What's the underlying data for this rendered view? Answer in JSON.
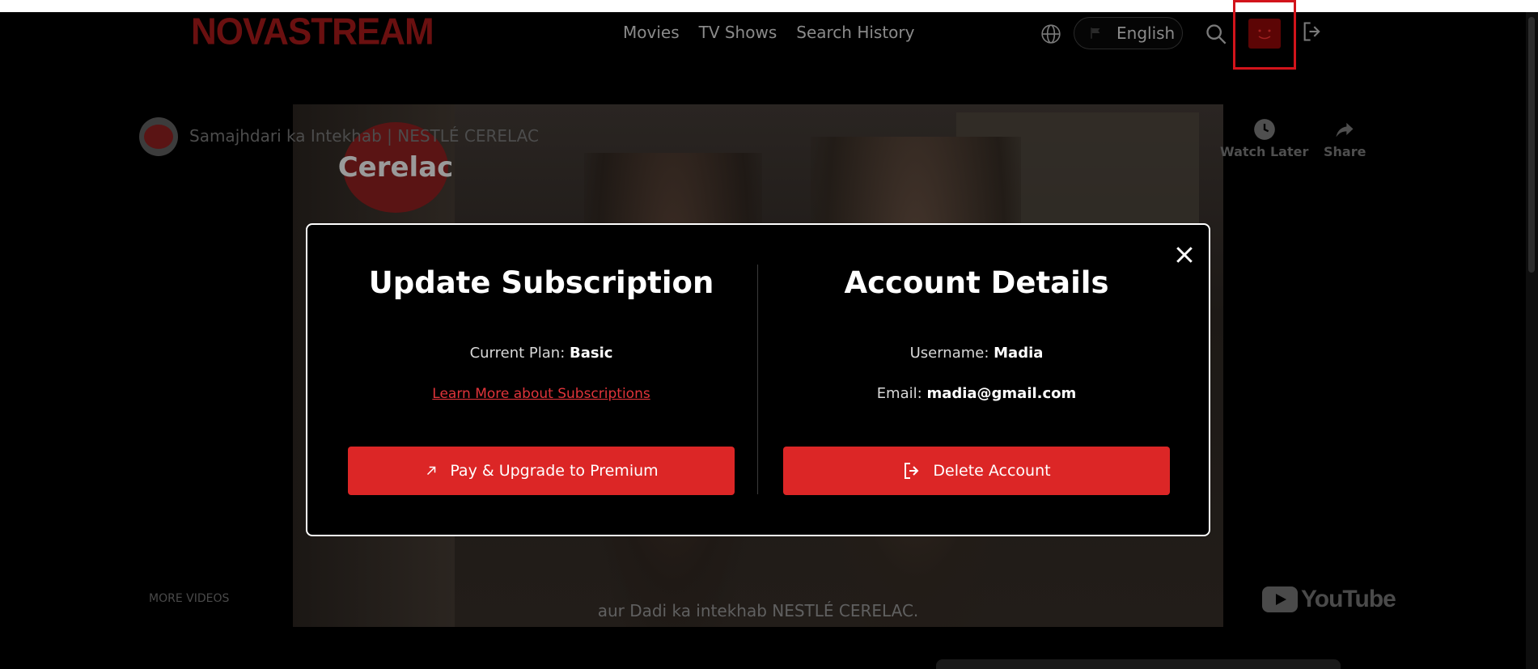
{
  "header": {
    "logo_text": "NOVASTREAM",
    "nav": [
      "Movies",
      "TV Shows",
      "Search History"
    ],
    "language": "English",
    "icons": [
      "globe-icon",
      "flag-icon",
      "search-icon",
      "avatar",
      "logout-icon"
    ]
  },
  "video": {
    "title": "Samajhdari ka Intekhab | NESTLÉ CERELAC",
    "logo_text": "Cerelac",
    "subtitle": "aur Dadi ka intekhab NESTLÉ CERELAC.",
    "watch_later": "Watch Later",
    "share": "Share",
    "more_videos": "MORE VIDEOS",
    "youtube": "YouTube"
  },
  "modal": {
    "subscription": {
      "title": "Update Subscription",
      "plan_label": "Current Plan:",
      "plan_value": "Basic",
      "learn_more": "Learn More about Subscriptions",
      "button": "Pay & Upgrade to Premium"
    },
    "account": {
      "title": "Account Details",
      "username_label": "Username:",
      "username_value": "Madia",
      "email_label": "Email:",
      "email_value": "madia@gmail.com",
      "button": "Delete Account"
    }
  },
  "colors": {
    "accent": "#dc2626",
    "highlight_box": "#d2141b",
    "background": "#000000"
  }
}
